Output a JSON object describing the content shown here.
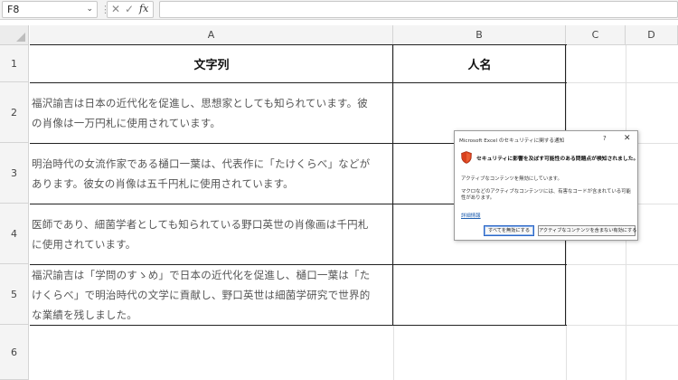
{
  "formula_bar": {
    "name_box": "F8",
    "name_box_arrow": "⌄",
    "separator": "⋮",
    "cancel_glyph": "✕",
    "enter_glyph": "✓",
    "fx_label": "fx",
    "formula": ""
  },
  "columns": [
    "A",
    "B",
    "C",
    "D"
  ],
  "rows": [
    "1",
    "2",
    "3",
    "4",
    "5",
    "6"
  ],
  "table": {
    "headers": [
      "文字列",
      "人名"
    ],
    "cells": [
      [
        "福沢諭吉は日本の近代化を促進し、思想家としても知られています。彼",
        "の肖像は一万円札に使用されています。"
      ],
      [
        "明治時代の女流作家である樋口一葉は、代表作に「たけくらべ」などが",
        "あります。彼女の肖像は五千円札に使用されています。"
      ],
      [
        "医師であり、細菌学者としても知られている野口英世の肖像画は千円札",
        "に使用されています。"
      ],
      [
        "福沢諭吉は「学問のすゝめ」で日本の近代化を促進し、樋口一葉は「た",
        "けくらべ」で明治時代の文学に貢献し、野口英世は細菌学研究で世界的",
        "な業績を残しました。"
      ]
    ]
  },
  "dialog": {
    "title": "Microsoft Excel のセキュリティに関する通知",
    "help": "?",
    "close": "✕",
    "shield_icon": "shield-warning",
    "shield_color": "#d9411e",
    "heading": "セキュリティに影響を及ぼす可能性のある問題点が検知されました。",
    "message1": "アクティブなコンテンツを無効にしています。",
    "message2": "マクロなどのアクティブなコンテンツには、有害なコードが含まれている可能性があります。",
    "link": "詳細情報",
    "button_disable": "すべてを無効にする",
    "button_enable": "アクティブなコンテンツを含まない有効にする"
  }
}
